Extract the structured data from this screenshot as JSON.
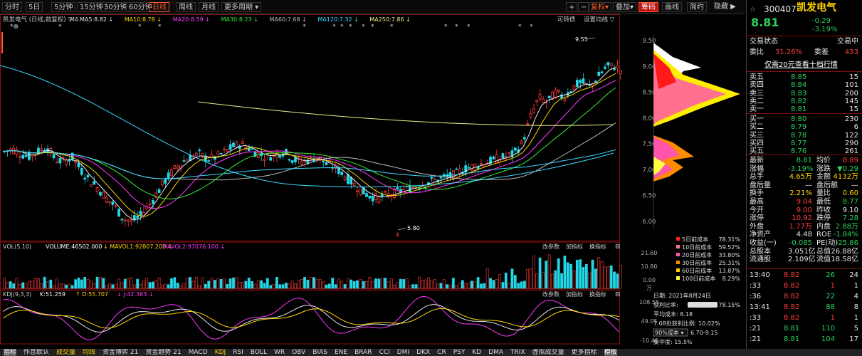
{
  "toolbar": {
    "items": [
      "分时",
      "5日",
      "5分钟",
      "15分钟",
      "30分钟",
      "60分钟",
      "日线",
      "周线",
      "月线",
      "更多周期"
    ],
    "active": "日线",
    "right": [
      "+",
      "−",
      "复权",
      "叠加",
      "筹码",
      "画线",
      "简约"
    ],
    "right_active": "筹码",
    "hide": "隐藏"
  },
  "stock": {
    "name": "凯发电气",
    "code": "300407",
    "price": "8.81",
    "change": "-0.29",
    "pct": "-3.19%"
  },
  "ma_legend": {
    "title": "凯发电气  (日线,前复权) ▽",
    "items": [
      {
        "t": "MA5:8.82",
        "c": "#e6e6e6"
      },
      {
        "t": "MA10:8.78",
        "c": "#ffd700"
      },
      {
        "t": "MA20:8.59",
        "c": "#ff38ff"
      },
      {
        "t": "MA30:8.23",
        "c": "#33ee33"
      },
      {
        "t": "MA60:7.68",
        "c": "#bbbbbb"
      },
      {
        "t": "MA120:7.32",
        "c": "#3ad9ff"
      },
      {
        "t": "MA250:7.86",
        "c": "#eeee88"
      }
    ]
  },
  "convert": "可转债",
  "setpos": "设置均线",
  "ylabels": [
    "9.50",
    "9.00",
    "8.50",
    "8.00",
    "7.50",
    "7.00",
    "6.50",
    "6.00"
  ],
  "high_label": "9.55",
  "low_label": "5.80",
  "vol": {
    "title": "VOL(5,10)",
    "vol": "VOLUME:46502.000",
    "ma1": "MAVOL1:92807.200",
    "ma2": "MAVOL2:97076.100",
    "ylabels": [
      "21.60",
      "10.80",
      "0.00"
    ],
    "unit": "万",
    "tools": [
      "改参数",
      "加指标",
      "换指标"
    ]
  },
  "kdj": {
    "title": "KDJ(9,3,3)",
    "k": "K:51.259",
    "d": "D:55.707",
    "j": "J:42.363",
    "ylabels": [
      "108.55",
      "49.05",
      "-10.46"
    ],
    "tools": [
      "改参数",
      "加指标",
      "换指标"
    ]
  },
  "months": [
    "2021",
    "02",
    "03",
    "04",
    "05",
    "06",
    "07",
    "08"
  ],
  "cost": {
    "items": [
      {
        "l": "5日前成本",
        "v": "78.31%",
        "c": "#ff2020"
      },
      {
        "l": "10日前成本",
        "v": "59.52%",
        "c": "#ff7090"
      },
      {
        "l": "20日前成本",
        "v": "33.80%",
        "c": "#ff55aa"
      },
      {
        "l": "30日前成本",
        "v": "25.31%",
        "c": "#ff8c00"
      },
      {
        "l": "60日前成本",
        "v": "13.87%",
        "c": "#ffd000"
      },
      {
        "l": "100日前成本",
        "v": "8.29%",
        "c": "#ffff40"
      }
    ],
    "date": "日期: 2021年8月24日",
    "profit_l": "获利比率:",
    "profit": "78.15%",
    "avg": "平均成本: 8.18",
    "dist": "7.08处获利比例: 10.02%",
    "range_sel": "90%成本",
    "range": "6.70-9.15",
    "conc": "集中度: 15.5%"
  },
  "status": {
    "trade": "交易状态",
    "trading": "交易中",
    "weibi_l": "委比",
    "weibi": "31.26%",
    "weicha_l": "委差",
    "weicha": "433",
    "banner": "仅需20元查看十档行情"
  },
  "sells": [
    {
      "l": "卖五",
      "p": "8.85",
      "v": "15"
    },
    {
      "l": "卖四",
      "p": "8.84",
      "v": "101"
    },
    {
      "l": "卖三",
      "p": "8.83",
      "v": "200"
    },
    {
      "l": "卖二",
      "p": "8.82",
      "v": "145"
    },
    {
      "l": "卖一",
      "p": "8.81",
      "v": "15"
    }
  ],
  "buys": [
    {
      "l": "买一",
      "p": "8.80",
      "v": "230"
    },
    {
      "l": "买二",
      "p": "8.79",
      "v": "6"
    },
    {
      "l": "买三",
      "p": "8.78",
      "v": "122"
    },
    {
      "l": "买四",
      "p": "8.77",
      "v": "290"
    },
    {
      "l": "买五",
      "p": "8.76",
      "v": "261"
    }
  ],
  "stats": [
    [
      "最新",
      "8.81",
      "均价",
      "8.89"
    ],
    [
      "涨幅",
      "-3.19%",
      "涨跌",
      "▼0.29"
    ],
    [
      "总手",
      "4.65万",
      "金额",
      "4132万"
    ],
    [
      "盘后量",
      "—",
      "盘后额",
      "—"
    ],
    [
      "换手",
      "2.21%",
      "量比",
      "0.60"
    ],
    [
      "最高",
      "9.04",
      "最低",
      "8.77"
    ],
    [
      "今开",
      "9.00",
      "昨收",
      "9.10"
    ],
    [
      "涨停",
      "10.92",
      "跌停",
      "7.28"
    ],
    [
      "外盘",
      "1.77万",
      "内盘",
      "2.88万"
    ],
    [
      "净资产",
      "4.48",
      "ROE",
      "-1.84%"
    ],
    [
      "收益(一)",
      "-0.085",
      "PE(动)",
      "-25.86"
    ],
    [
      "总股本",
      "3.051亿",
      "总值",
      "26.88亿"
    ],
    [
      "流通股",
      "2.109亿",
      "流值",
      "18.58亿"
    ]
  ],
  "ticks": [
    {
      "t": "13:40",
      "p": "8.82",
      "v": "26",
      "n": "24"
    },
    {
      "t": ":33",
      "p": "8.82",
      "v": "1",
      "n": "1"
    },
    {
      "t": ":36",
      "p": "8.82",
      "v": "22",
      "n": "4"
    },
    {
      "t": "13:41",
      "p": "8.82",
      "v": "88",
      "n": "8"
    },
    {
      "t": ":33",
      "p": "8.82",
      "v": "1",
      "n": "1"
    },
    {
      "t": ":21",
      "p": "8.81",
      "v": "110",
      "n": "5"
    },
    {
      "t": ":21",
      "p": "8.81",
      "v": "104",
      "n": "17"
    }
  ],
  "bottom": [
    "指标",
    "作息默认",
    "成交量",
    "均线",
    "资金博弈 21",
    "资金趋势 21",
    "MACD",
    "KDJ",
    "RSI",
    "BOLL",
    "WR",
    "OBV",
    "BIAS",
    "ENE",
    "BRAR",
    "CCI",
    "DMI",
    "DKX",
    "CR",
    "PSY",
    "KD",
    "DMA",
    "TRIX",
    "虚拟成交量",
    "更多指标",
    "模板"
  ]
}
